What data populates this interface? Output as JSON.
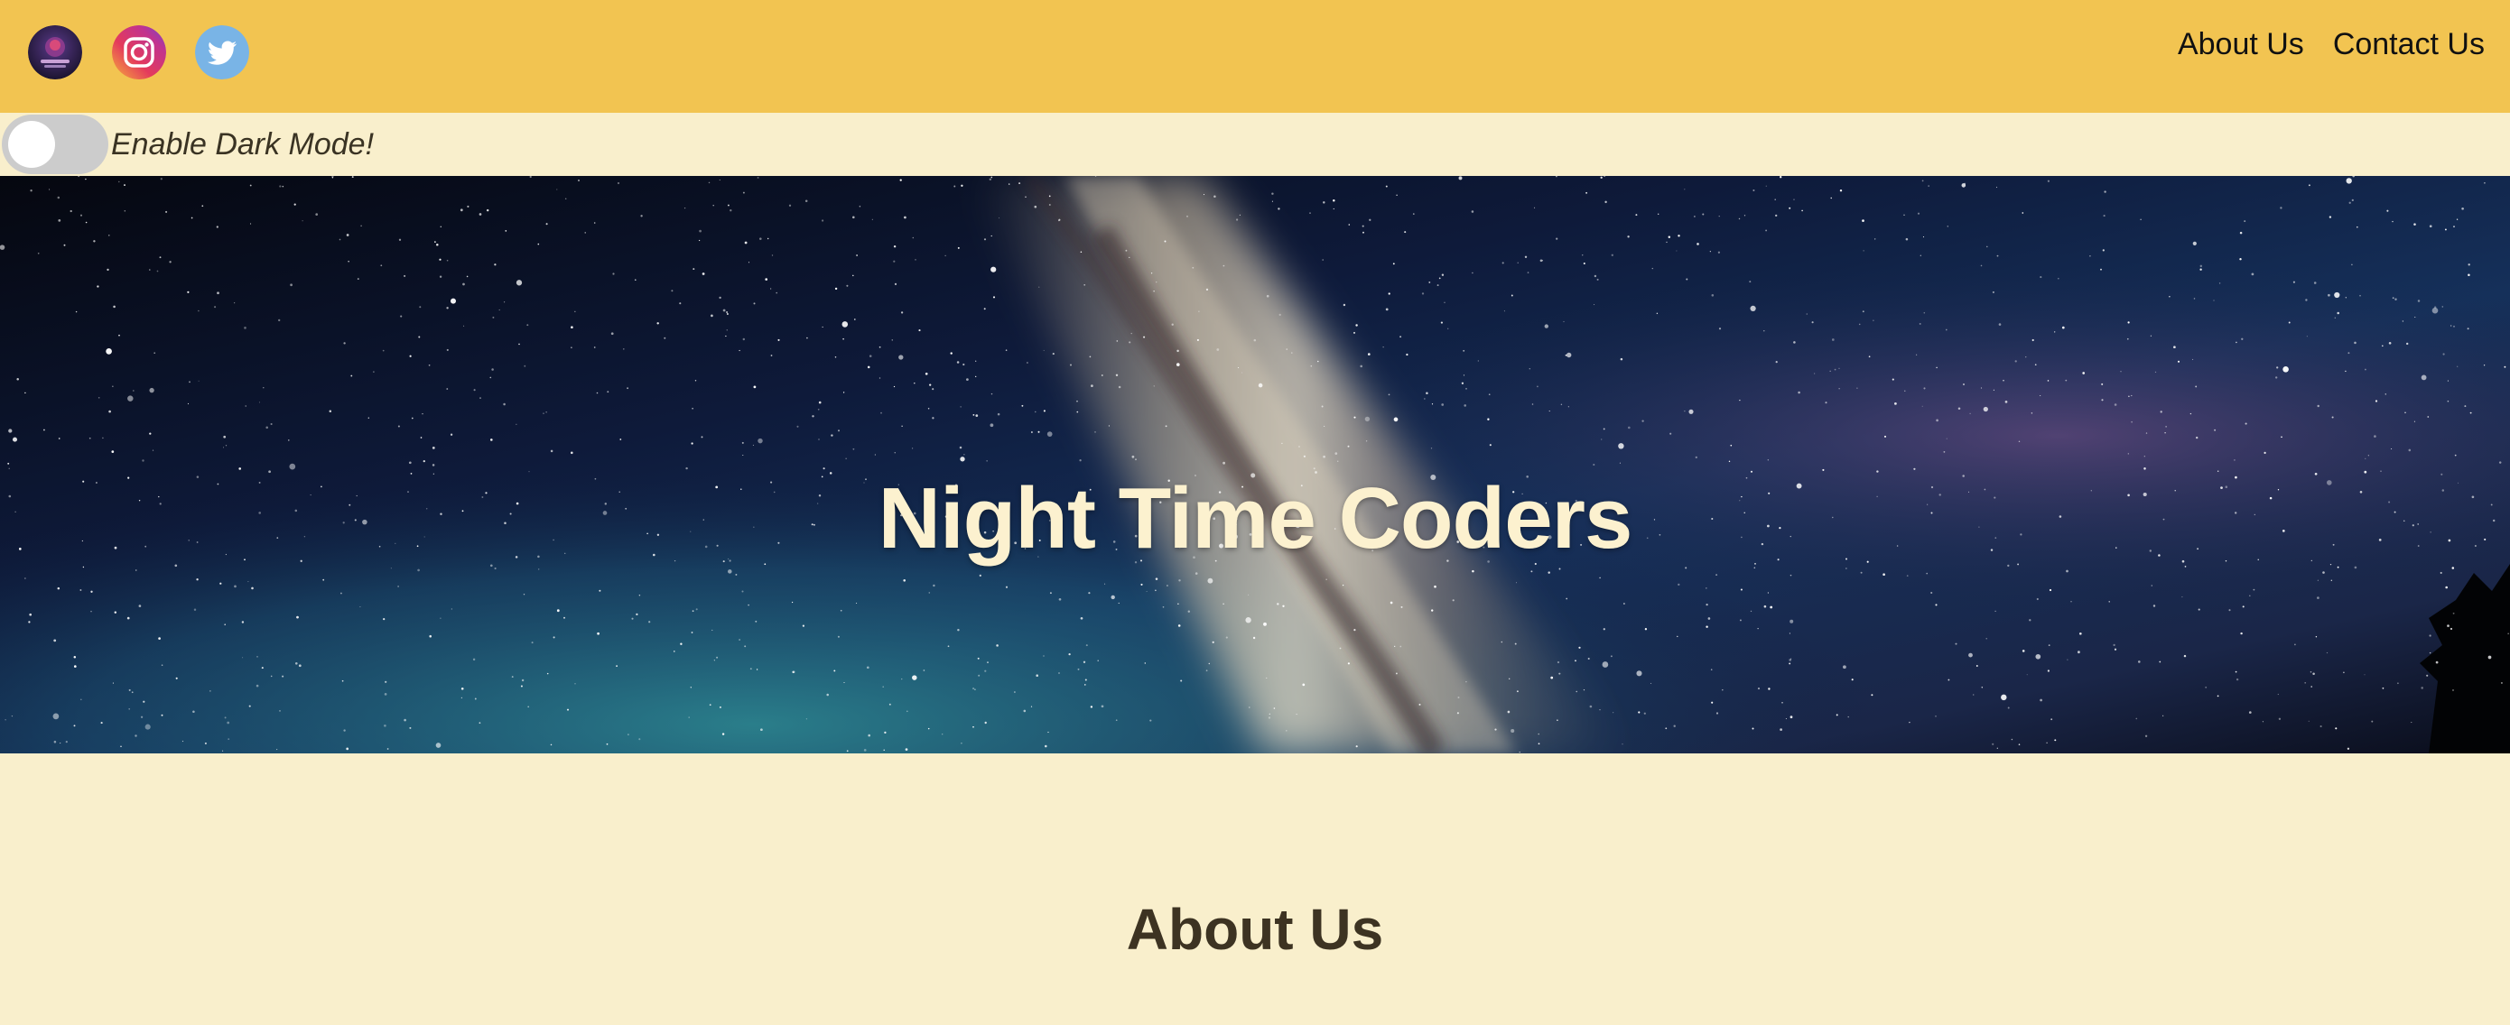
{
  "navbar": {
    "social_icons": [
      {
        "name": "night-time-coders-logo",
        "icon": "club-logo-icon"
      },
      {
        "name": "instagram",
        "icon": "instagram-icon"
      },
      {
        "name": "twitter",
        "icon": "twitter-icon"
      }
    ],
    "links": [
      "About Us",
      "Contact Us"
    ]
  },
  "dark_mode": {
    "label": "Enable Dark Mode!",
    "enabled": false
  },
  "hero": {
    "title": "Night Time Coders"
  },
  "about": {
    "heading": "About Us"
  },
  "colors": {
    "navbar_bg": "#f2c451",
    "page_bg": "#f9efcc",
    "hero_title": "#fcf1cf",
    "heading_text": "#3d3322",
    "toggle_track": "#cccccc"
  }
}
